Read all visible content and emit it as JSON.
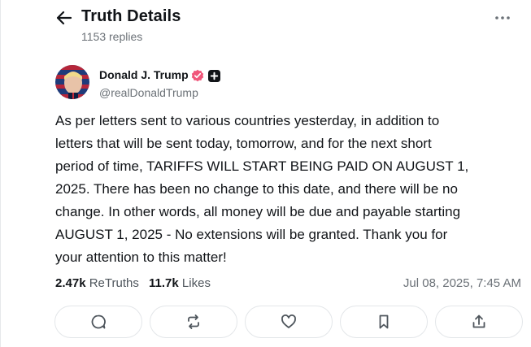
{
  "header": {
    "title": "Truth Details",
    "reply_count": "1153 replies"
  },
  "post": {
    "author": {
      "name": "Donald J. Trump",
      "handle": "@realDonaldTrump",
      "verified_color": "#f0567a"
    },
    "body": "As per letters sent to various countries yesterday, in addition to\nletters that will be sent today, tomorrow, and for the next short\nperiod of time, TARIFFS WILL START BEING PAID ON AUGUST 1,\n2025. There has been no change to this date, and there will be no\nchange. In other words, all money will be due and payable starting\nAUGUST 1, 2025 - No extensions will be granted. Thank you for\nyour attention to this matter!",
    "stats": {
      "retruths_count": "2.47k",
      "retruths_label": "ReTruths",
      "likes_count": "11.7k",
      "likes_label": "Likes"
    },
    "timestamp": "Jul 08, 2025, 7:45 AM"
  },
  "actions": [
    {
      "icon": "reply-icon"
    },
    {
      "icon": "retruth-icon"
    },
    {
      "icon": "like-icon"
    },
    {
      "icon": "bookmark-icon"
    },
    {
      "icon": "share-icon"
    }
  ],
  "colors": {
    "text": "#111418",
    "muted": "#6b7177",
    "border": "#e3e6e9",
    "verified": "#f0567a"
  }
}
